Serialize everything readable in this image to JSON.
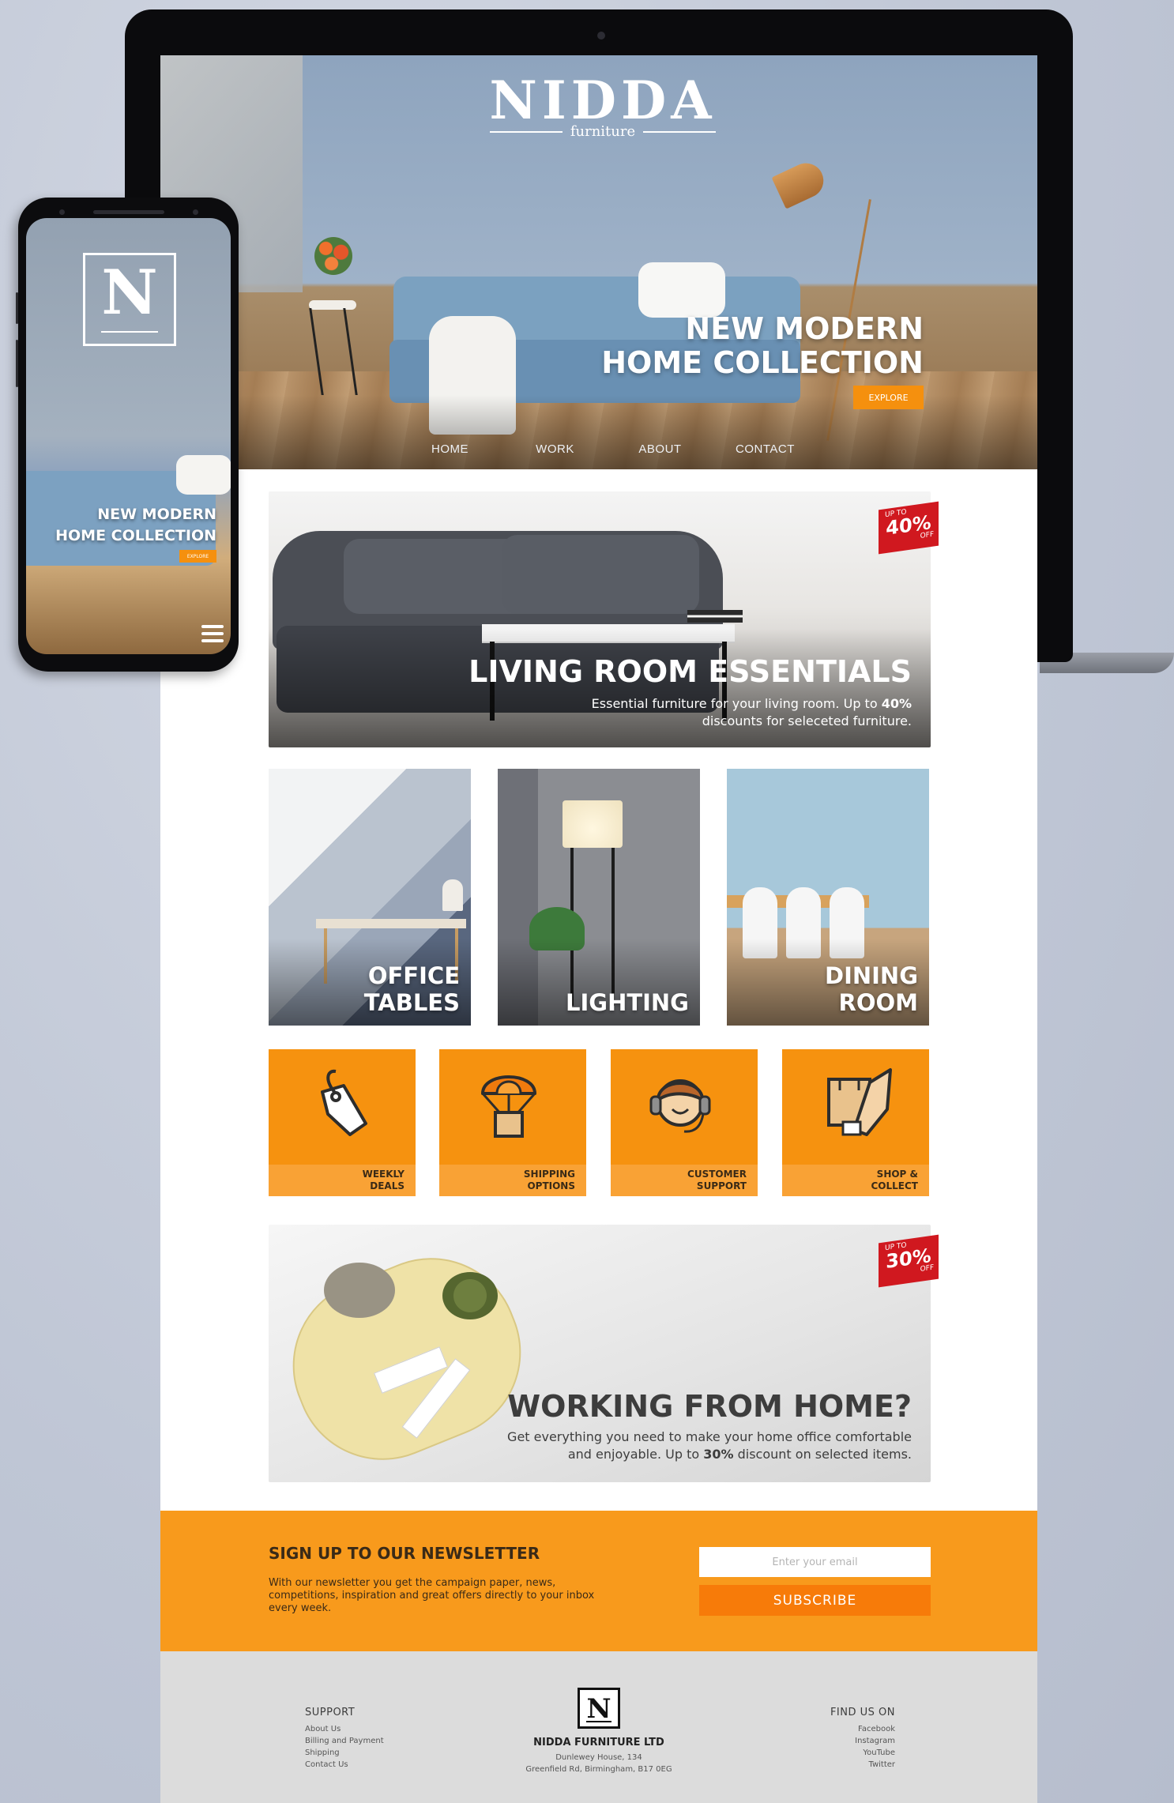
{
  "brand": {
    "name": "NIDDA",
    "tagline": "furniture",
    "monogram": "N",
    "accent": "#f5900e",
    "sale_red": "#d0181f"
  },
  "hero": {
    "title_line1": "NEW MODERN",
    "title_line2": "HOME COLLECTION",
    "cta": "EXPLORE"
  },
  "nav": {
    "items": [
      "HOME",
      "WORK",
      "ABOUT",
      "CONTACT"
    ]
  },
  "living_banner": {
    "title": "LIVING ROOM ESSENTIALS",
    "desc_line1_prefix": "Essential furniture for your living room. Up to ",
    "desc_pct": "40%",
    "desc_line2": "discounts for seleceted furniture.",
    "badge": {
      "up_to": "UP TO",
      "pct": "40%",
      "off": "OFF"
    }
  },
  "categories": [
    {
      "line1": "OFFICE",
      "line2": "TABLES"
    },
    {
      "line1": "",
      "line2": "LIGHTING"
    },
    {
      "line1": "DINING",
      "line2": "ROOM"
    }
  ],
  "services": [
    {
      "line1": "WEEKLY",
      "line2": "DEALS",
      "icon": "price-tag-icon"
    },
    {
      "line1": "SHIPPING",
      "line2": "OPTIONS",
      "icon": "parachute-box-icon"
    },
    {
      "line1": "CUSTOMER",
      "line2": "SUPPORT",
      "icon": "headset-agent-icon"
    },
    {
      "line1": "SHOP &",
      "line2": "COLLECT",
      "icon": "box-hand-icon"
    }
  ],
  "wfh_banner": {
    "title": "WORKING FROM HOME?",
    "desc_line1": "Get everything you need to make your home office comfortable",
    "desc_line2_prefix": "and enjoyable. Up to ",
    "desc_pct": "30%",
    "desc_line2_suffix": " discount on selected items.",
    "badge": {
      "up_to": "UP TO",
      "pct": "30%",
      "off": "OFF"
    }
  },
  "newsletter": {
    "title": "SIGN UP TO OUR NEWSLETTER",
    "text": "With our newsletter you get the campaign paper, news, competitions, inspiration and great offers directly to your inbox every week.",
    "placeholder": "Enter your email",
    "button": "SUBSCRIBE"
  },
  "footer": {
    "support_title": "SUPPORT",
    "support_links": [
      "About Us",
      "Billing and Payment",
      "Shipping",
      "Contact Us"
    ],
    "company": "NIDDA FURNITURE LTD",
    "address_line1": "Dunlewey House, 134",
    "address_line2": "Greenfield Rd, Birmingham, B17 0EG",
    "find_title": "FIND US ON",
    "find_links": [
      "Facebook",
      "Instagram",
      "YouTube",
      "Twitter"
    ]
  },
  "phone": {
    "monogram": "N",
    "title_line1": "NEW MODERN",
    "title_line2": "HOME COLLECTION",
    "cta": "EXPLORE"
  }
}
